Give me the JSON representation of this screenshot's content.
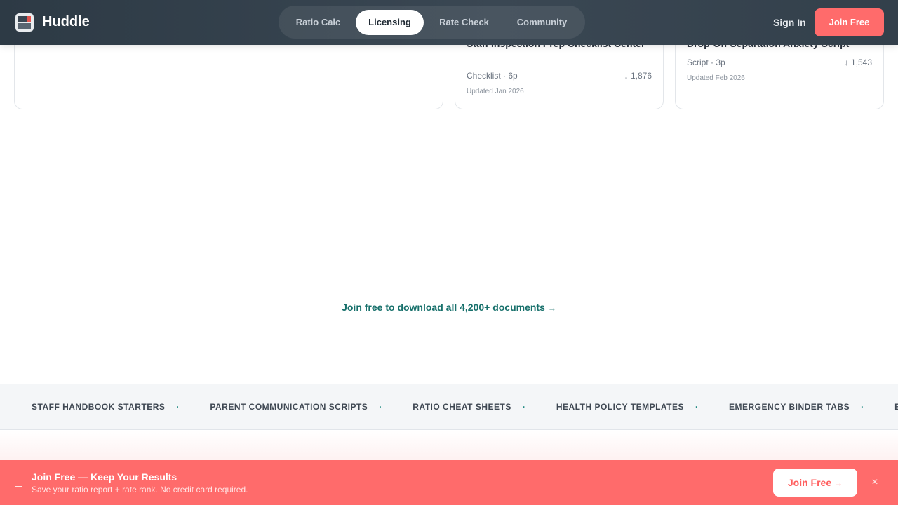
{
  "header": {
    "brand": "Huddle",
    "logo_icon": "calendar-notebook-icon",
    "nav": [
      {
        "label": "Ratio Calc",
        "active": false
      },
      {
        "label": "Licensing",
        "active": true
      },
      {
        "label": "Rate Check",
        "active": false
      },
      {
        "label": "Community",
        "active": false
      }
    ],
    "sign_in": "Sign In",
    "join_free": "Join Free"
  },
  "documents": [
    {
      "title": "Staff Inspection Prep Checklist Center",
      "meta": "Checklist · 6p",
      "downloads": "↓ 1,876",
      "updated": "Updated Jan 2026"
    },
    {
      "title": "Drop-Off Separation Anxiety Script",
      "meta": "Script · 3p",
      "downloads": "↓ 1,543",
      "updated": "Updated Feb 2026"
    }
  ],
  "cta": {
    "text": "Join free to download all 4,200+ documents",
    "arrow": "→"
  },
  "band": {
    "items": [
      "Staff Handbook Starters",
      "Parent Communication Scripts",
      "Ratio Cheat Sheets",
      "Health Policy Templates",
      "Emergency Binder Tabs",
      "E"
    ],
    "separator": "·"
  },
  "bottom_bar": {
    "icon": "document-icon",
    "title": "Join Free — Keep Your Results",
    "subtitle": "Save your ratio report + rate rank. No credit card required.",
    "button": "Join Free",
    "button_arrow": "→",
    "close": "×"
  },
  "colors": {
    "accent": "#ff6b6b",
    "header_bg": "#34414c",
    "link": "#17706b",
    "band_bg": "#f4f6f8"
  }
}
